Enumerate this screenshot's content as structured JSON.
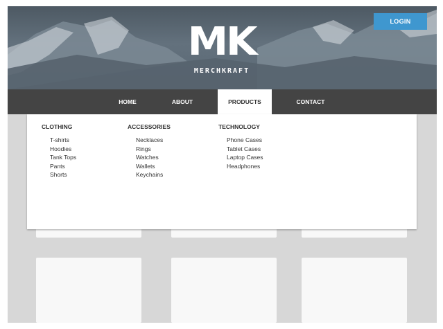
{
  "header": {
    "logo_mark": "MK",
    "logo_text": "MERCHKRAFT",
    "login_label": "LOGIN"
  },
  "nav": {
    "items": [
      {
        "label": "HOME"
      },
      {
        "label": "ABOUT"
      },
      {
        "label": "PRODUCTS",
        "active": true
      },
      {
        "label": "CONTACT"
      }
    ]
  },
  "dropdown": {
    "columns": [
      {
        "title": "CLOTHING",
        "items": [
          "T-shirts",
          "Hoodies",
          "Tank Tops",
          "Pants",
          "Shorts"
        ]
      },
      {
        "title": "ACCESSORIES",
        "items": [
          "Necklaces",
          "Rings",
          "Watches",
          "Wallets",
          "Keychains"
        ]
      },
      {
        "title": "TECHNOLOGY",
        "items": [
          "Phone Cases",
          "Tablet Cases",
          "Laptop Cases",
          "Headphones"
        ]
      }
    ]
  },
  "colors": {
    "login": "#3f97cf",
    "navbar": "#444444",
    "page_bg": "#d7d7d7"
  }
}
